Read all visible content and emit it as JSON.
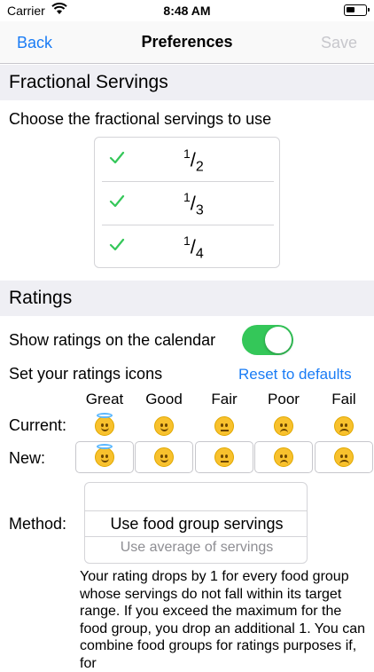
{
  "status": {
    "carrier": "Carrier",
    "time": "8:48 AM"
  },
  "nav": {
    "back": "Back",
    "title": "Preferences",
    "save": "Save"
  },
  "fractional": {
    "header": "Fractional Servings",
    "instruction": "Choose the fractional servings to use",
    "options": [
      {
        "num": "1",
        "den": "2",
        "checked": true
      },
      {
        "num": "1",
        "den": "3",
        "checked": true
      },
      {
        "num": "1",
        "den": "4",
        "checked": true
      }
    ]
  },
  "ratings": {
    "header": "Ratings",
    "show_label": "Show ratings on the calendar",
    "show_enabled": true,
    "icons_label": "Set your ratings icons",
    "reset_link": "Reset to defaults",
    "columns": [
      "Great",
      "Good",
      "Fair",
      "Poor",
      "Fail"
    ],
    "current_label": "Current:",
    "new_label": "New:",
    "method_label": "Method:",
    "method_options": [
      "Use food group servings",
      "Use average of servings"
    ],
    "method_selected": "Use food group servings",
    "description": "Your rating drops by 1 for every food group whose servings do not fall within its target range. If you exceed the maximum for the food group, you drop an additional 1. You can combine food groups for ratings purposes if, for"
  },
  "colors": {
    "accent": "#1a7cf5",
    "toggle_on": "#34c759",
    "check": "#34c759",
    "disabled": "#c7c7cc"
  },
  "icons": [
    "wifi-icon",
    "battery-icon",
    "checkmark-icon",
    "halo-face-icon",
    "smile-face-icon",
    "neutral-face-icon",
    "slight-frown-face-icon",
    "frown-face-icon"
  ]
}
